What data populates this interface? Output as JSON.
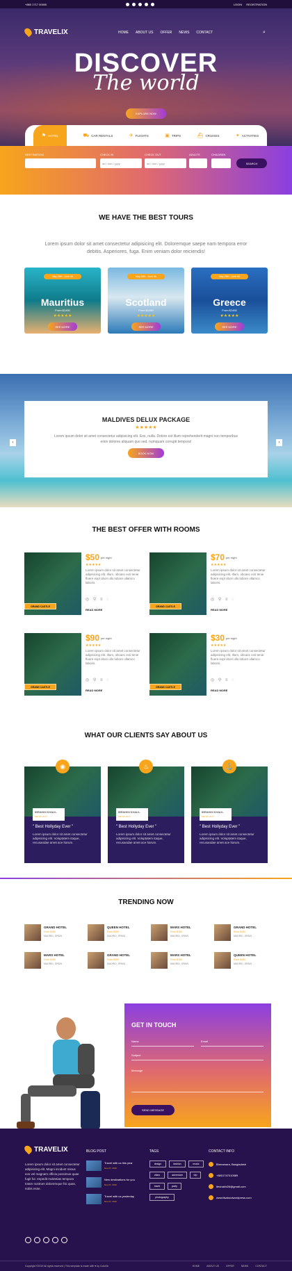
{
  "topbar": {
    "phone": "+880 1717 00000",
    "links": [
      "LOGIN",
      "REGISTRATION"
    ]
  },
  "brand": "TRAVELIX",
  "nav": [
    "HOME",
    "ABOUT US",
    "OFFER",
    "NEWS",
    "CONTACT"
  ],
  "hero": {
    "title": "DISCOVER",
    "subtitle": "The world",
    "cta": "EXPLORE NOW"
  },
  "tabs": [
    {
      "icon": "hotel-icon",
      "label": "HOTEL"
    },
    {
      "icon": "car-icon",
      "label": "CAR RENTALS"
    },
    {
      "icon": "plane-icon",
      "label": "FLIGHTS"
    },
    {
      "icon": "suitcase-icon",
      "label": "TRIPS"
    },
    {
      "icon": "ship-icon",
      "label": "CRUISES"
    },
    {
      "icon": "activities-icon",
      "label": "ACTIVITIES"
    }
  ],
  "booking": {
    "destination": "DESTINATION",
    "check_in": "CHECK IN",
    "check_out": "CHECK OUT",
    "adults": "ADULTS",
    "children": "CHILDREN",
    "date_placeholder": "dd / mm / yyyy",
    "search": "SEARCH"
  },
  "tours": {
    "title": "WE HAVE THE BEST TOURS",
    "lead": "Lorem ipsum dolor sit amet consectetur adipisicing elit. Doloremque saepe nam tempora error debitis. Asperiores, fuga. Enim veniam dolor reiciendis!",
    "items": [
      {
        "badge": "May 25th - June 06",
        "name": "Mauritius",
        "from": "From $1450",
        "stars": "★★★★★",
        "cta": "SEE MORE"
      },
      {
        "badge": "May 25th - June 06",
        "name": "Scotland",
        "from": "From $1450",
        "stars": "★★★★★",
        "cta": "SEE MORE"
      },
      {
        "badge": "May 25th - June 06",
        "name": "Greece",
        "from": "From $1450",
        "stars": "★★★★★",
        "cta": "SEE MORE"
      }
    ]
  },
  "maldives": {
    "title": "MALDIVES DELUX PACKAGE",
    "stars": "★★★★★",
    "text": "Lorem ipsum dolor sit amet consectetur adipisicing elit. Eos, nulla. Dolore est illum reprehenderit magni non temporibus enim dolores aliquam quo sed, numquam corrupti tempora!",
    "cta": "BOOK NOW",
    "prev": "‹",
    "next": "›"
  },
  "rooms": {
    "title": "THE BEST OFFER WITH ROOMS",
    "items": [
      {
        "price": "$50",
        "per": "per night",
        "tag": "GRAND CASTLE"
      },
      {
        "price": "$70",
        "per": "per night",
        "tag": "GRAND CASTLE"
      },
      {
        "price": "$90",
        "per": "per night",
        "tag": "GRAND CASTLE"
      },
      {
        "price": "$30",
        "per": "per night",
        "tag": "GRAND CASTLE"
      }
    ],
    "stars": "★★★★★",
    "text": "Lorem ipsum dolor sit amet consectetur adipisicing elit. Illum, obcaec ecti tenie fluere expl obori ullo lubore ullamco laboris.",
    "icons": "◎ ⚲ ≡ ◌",
    "more": "READ MORE"
  },
  "clients": {
    "title": "WHAT OUR CLIENTS SAY ABOUT US",
    "items": [
      {
        "icon": "camera-icon",
        "glyph": "◉",
        "name": "IBRAHIM KHALIL",
        "date": "Mar 24, 2017"
      },
      {
        "icon": "drink-icon",
        "glyph": "♨",
        "name": "IBRAHIM KHALIL",
        "date": "Mar 24, 2017"
      },
      {
        "icon": "anchor-icon",
        "glyph": "⚓",
        "name": "IBRAHIM KHALIL",
        "date": "Mar 24, 2017"
      }
    ],
    "quote": "\" Best Hollyday Ever \"",
    "text": "Lorem ipsum dolor sit amet consectetur adipisicing elit. Voluptatem itaque, recusandae amet ace harum."
  },
  "trending": {
    "title": "TRENDING NOW",
    "items": [
      {
        "name": "GRAND HOTEL",
        "price": "From $180",
        "loc": "MADRID, SPAIN"
      },
      {
        "name": "QUEEN HOTEL",
        "price": "From $180",
        "loc": "MADRID, SPAIN"
      },
      {
        "name": "MARS HOTEL",
        "price": "From $180",
        "loc": "MADRID, SPAIN"
      },
      {
        "name": "GRAND HOTEL",
        "price": "From $180",
        "loc": "MADRID, SPAIN"
      },
      {
        "name": "MARS HOTEL",
        "price": "From $180",
        "loc": "MADRID, SPAIN"
      },
      {
        "name": "GRAND HOTEL",
        "price": "From $180",
        "loc": "MADRID, SPAIN"
      },
      {
        "name": "MARS HOTEL",
        "price": "From $180",
        "loc": "MADRID, SPAIN"
      },
      {
        "name": "QUEEN HOTEL",
        "price": "From $180",
        "loc": "MADRID, SPAIN"
      }
    ]
  },
  "contact": {
    "title": "GET IN TOUCH",
    "name": "Name",
    "email": "Email",
    "subject": "Subject",
    "message": "Message",
    "send": "SEND MESSAGE"
  },
  "footer": {
    "about": "Lorem ipsum dolor sit amet consectetur adipisicing elit. Magni incidunt minus eos vel magnam officia possimus quae fugit for. Impedit molestias tempora totam nostrum doloremque hic quas, nobis esse.",
    "blog_title": "BLOG POST",
    "posts": [
      {
        "t": "Travel with us this year",
        "d": "Nov 27, 2016"
      },
      {
        "t": "New destinations for you",
        "d": "Nov 27, 2016"
      },
      {
        "t": "Travel with us yesterday",
        "d": "Nov 27, 2016"
      }
    ],
    "tags_title": "TAGS",
    "tags": [
      "design",
      "fashion",
      "music",
      "video",
      "adventure",
      "trip",
      "travel",
      "party",
      "photography"
    ],
    "contact_title": "CONTACT INFO",
    "info": [
      "Bheramara, Bangladesh",
      "+8801747010589",
      "iteshakhi26@gmail.com",
      "www.itsaboutwordpress.com"
    ],
    "copyright": "Copyright ©2019 All rights reserved | This template is made with ♥ by Colorlib",
    "links": [
      "HOME",
      "ABOUT US",
      "OFFER",
      "NEWS",
      "CONTACT"
    ]
  }
}
